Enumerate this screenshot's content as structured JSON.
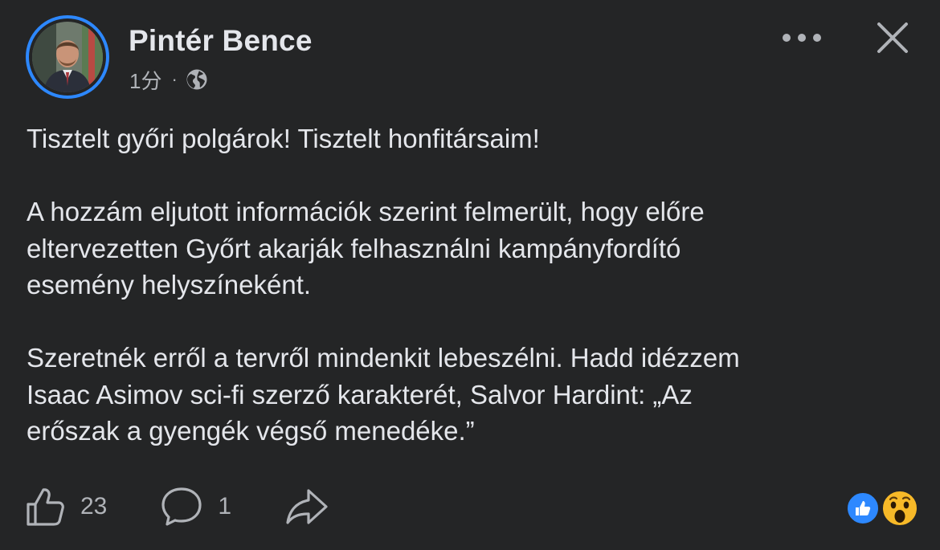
{
  "post": {
    "author_name": "Pintér Bence",
    "timestamp": "1分",
    "separator": "·",
    "privacy_icon": "globe-icon",
    "paragraphs": [
      [
        "Tisztelt győri polgárok! Tisztelt honfitársaim!"
      ],
      [
        "A hozzám eljutott információk szerint felmerült, hogy előre",
        "eltervezetten Győrt akarják felhasználni kampányfordító",
        "esemény helyszíneként."
      ],
      [
        "Szeretnék erről a tervről mindenkit lebeszélni. Hadd idézzem",
        "Isaac Asimov sci-fi szerző karakterét, Salvor Hardint: „Az",
        "erőszak a gyengék végső menedéke.”"
      ]
    ]
  },
  "header_actions": {
    "more_icon": "more-icon",
    "close_icon": "close-icon"
  },
  "engagement": {
    "like_count": "23",
    "comment_count": "1",
    "reactions": [
      "like",
      "wow"
    ]
  },
  "colors": {
    "background": "#242526",
    "text_primary": "#e4e6eb",
    "text_secondary": "#b0b3b8",
    "accent": "#2d88ff"
  }
}
